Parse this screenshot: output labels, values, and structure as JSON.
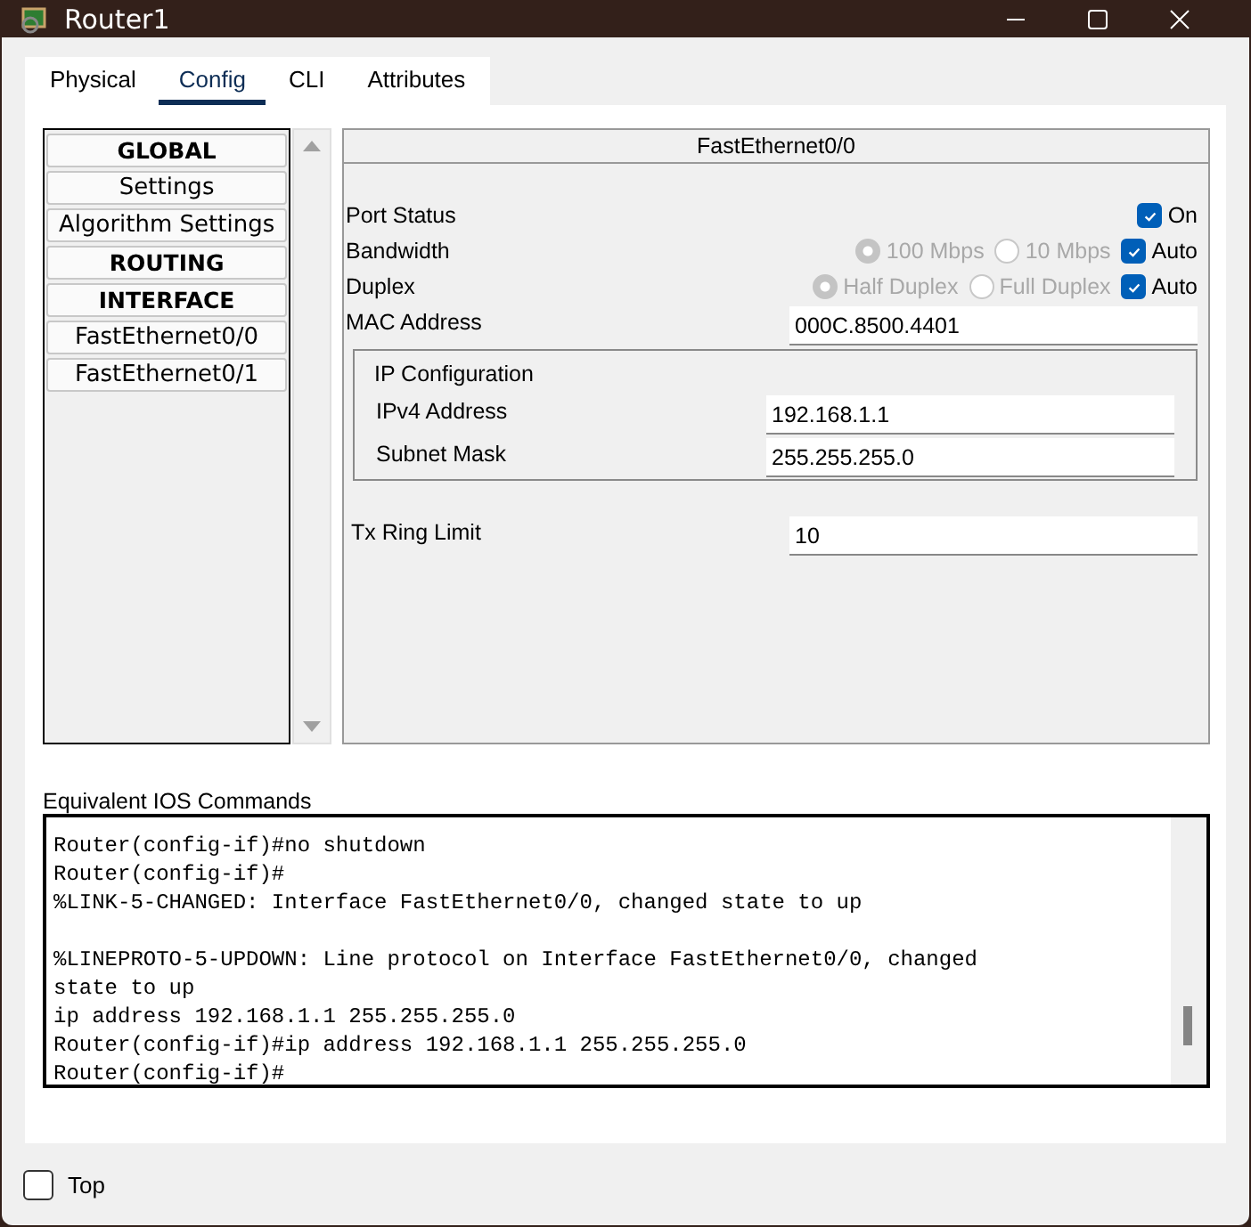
{
  "window": {
    "title": "Router1"
  },
  "tabs": [
    {
      "label": "Physical",
      "selected": false
    },
    {
      "label": "Config",
      "selected": true
    },
    {
      "label": "CLI",
      "selected": false
    },
    {
      "label": "Attributes",
      "selected": false
    }
  ],
  "sidebar": {
    "items": [
      {
        "label": "GLOBAL",
        "kind": "header"
      },
      {
        "label": "Settings",
        "kind": "item"
      },
      {
        "label": "Algorithm Settings",
        "kind": "item"
      },
      {
        "label": "ROUTING",
        "kind": "header"
      },
      {
        "label": "INTERFACE",
        "kind": "header"
      },
      {
        "label": "FastEthernet0/0",
        "kind": "item"
      },
      {
        "label": "FastEthernet0/1",
        "kind": "item"
      }
    ]
  },
  "panel": {
    "title": "FastEthernet0/0",
    "port_status": {
      "label": "Port Status",
      "option": "On",
      "checked": true
    },
    "bandwidth": {
      "label": "Bandwidth",
      "options": [
        {
          "label": "100 Mbps",
          "selected": true
        },
        {
          "label": "10 Mbps",
          "selected": false
        }
      ],
      "auto": {
        "label": "Auto",
        "checked": true
      }
    },
    "duplex": {
      "label": "Duplex",
      "options": [
        {
          "label": "Half Duplex",
          "selected": true
        },
        {
          "label": "Full Duplex",
          "selected": false
        }
      ],
      "auto": {
        "label": "Auto",
        "checked": true
      }
    },
    "mac_address": {
      "label": "MAC Address",
      "value": "000C.8500.4401"
    },
    "ip_configuration": {
      "title": "IP Configuration",
      "fields": [
        {
          "label": "IPv4 Address",
          "value": "192.168.1.1"
        },
        {
          "label": "Subnet Mask",
          "value": "255.255.255.0"
        }
      ]
    },
    "tx_ring_limit": {
      "label": "Tx Ring Limit",
      "value": "10"
    }
  },
  "commands": {
    "title": "Equivalent IOS Commands",
    "blocks": [
      {
        "lines": [
          "Router(config-if)#no shutdown",
          "Router(config-if)#",
          "%LINK-5-CHANGED: Interface FastEthernet0/0, changed state to up"
        ]
      },
      {
        "lines": [
          "%LINEPROTO-5-UPDOWN: Line protocol on Interface FastEthernet0/0, changed",
          "state to up",
          "ip address 192.168.1.1 255.255.255.0",
          "Router(config-if)#ip address 192.168.1.1 255.255.255.0",
          "Router(config-if)#"
        ]
      }
    ]
  },
  "top_checkbox": {
    "label": "Top",
    "checked": false
  }
}
